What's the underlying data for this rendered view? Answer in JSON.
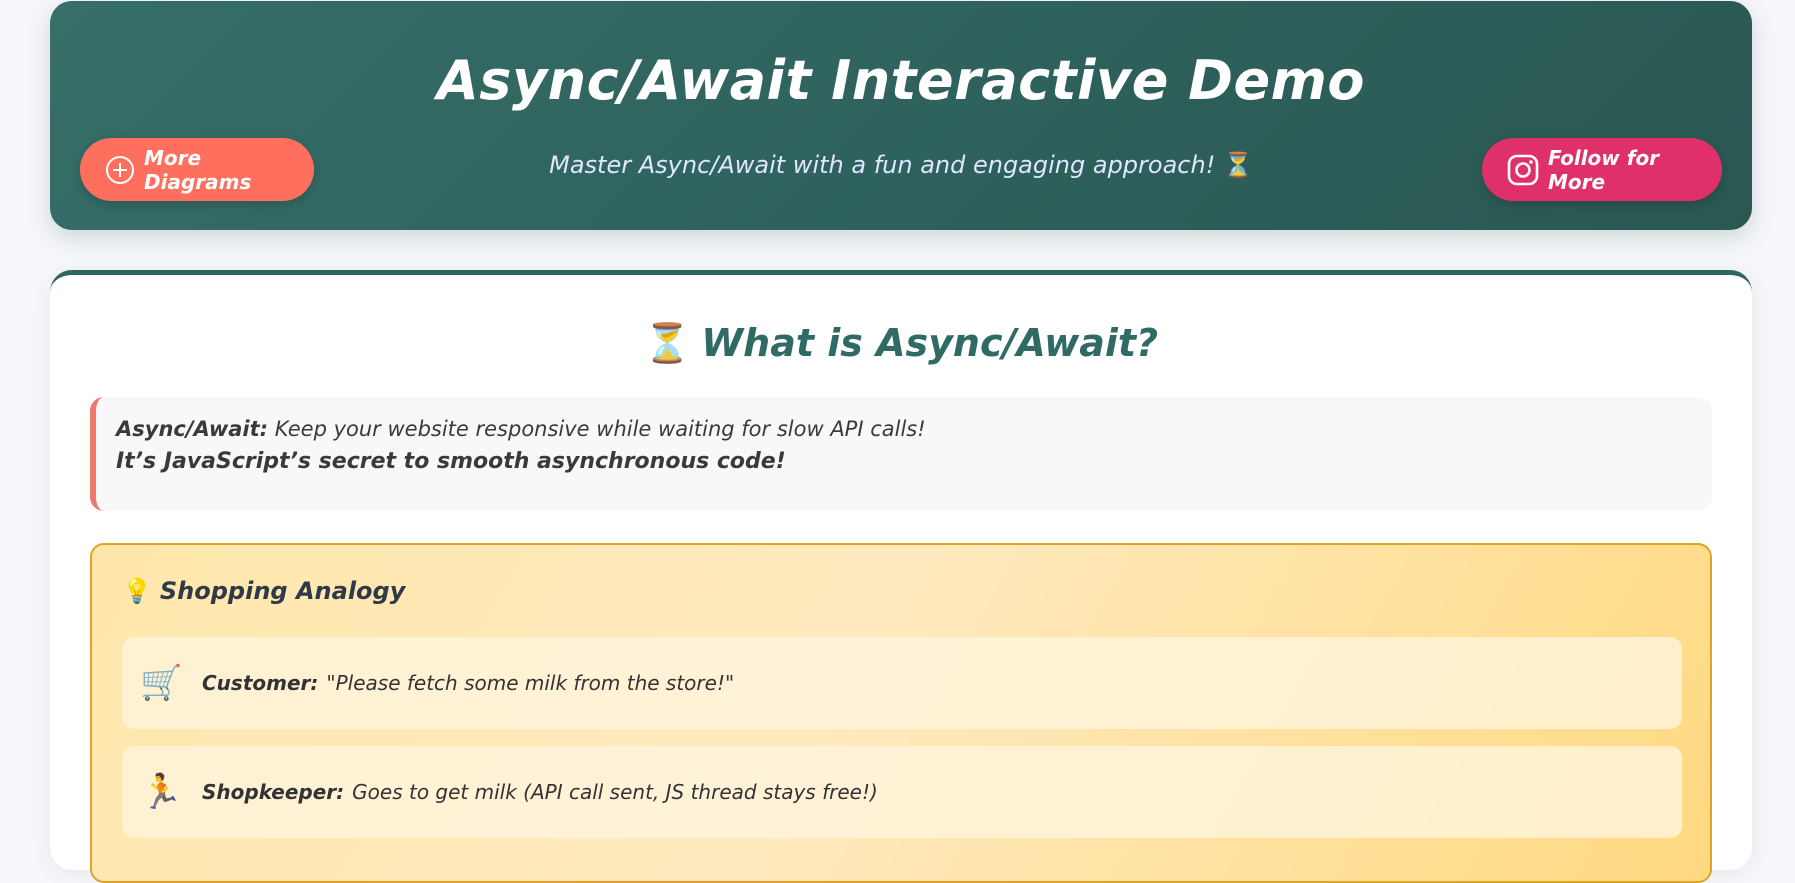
{
  "header": {
    "title": "Async/Await Interactive Demo",
    "subtitle": "Master Async/Await with a fun and engaging approach!",
    "subtitle_icon": "⏳",
    "more_button_label": "More Diagrams",
    "more_button_icon": "plus-circle-icon",
    "follow_button_label": "Follow for More",
    "follow_button_icon": "instagram-icon",
    "colors": {
      "header_bg": "#336a64",
      "more_button": "#ff6f5e",
      "follow_button": "#e0306a"
    }
  },
  "section": {
    "icon": "⏳",
    "title": "What is Async/Await?",
    "definition": {
      "term": "Async/Await:",
      "text": " Keep your website responsive while waiting for slow API calls!",
      "emphasis": "It’s JavaScript’s secret to smooth asynchronous code!"
    },
    "analogy": {
      "icon": "💡",
      "title": "Shopping Analogy",
      "rows": [
        {
          "icon": "🛒",
          "who": "Customer:",
          "text": "\"Please fetch some milk from the store!\""
        },
        {
          "icon": "🏃",
          "who": "Shopkeeper:",
          "text": "Goes to get milk (API call sent, JS thread stays free!)"
        }
      ]
    }
  }
}
